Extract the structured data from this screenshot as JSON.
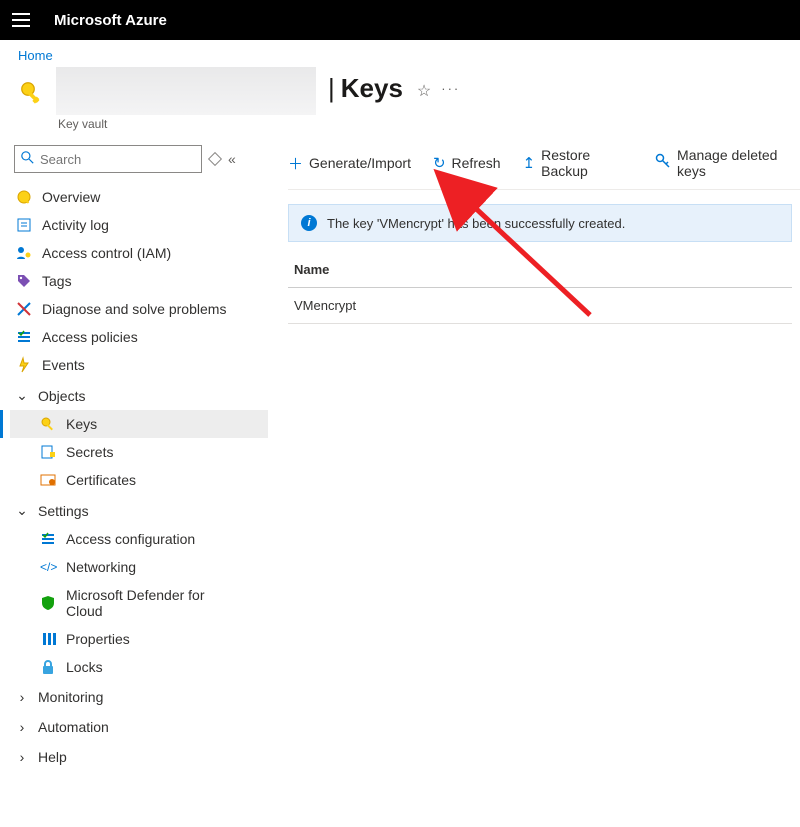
{
  "topbar": {
    "brand": "Microsoft Azure"
  },
  "breadcrumb": {
    "home": "Home"
  },
  "header": {
    "subtitle": "Key vault",
    "separator": "|",
    "title": "Keys",
    "more": "···"
  },
  "sidebar": {
    "search_placeholder": "Search",
    "items": {
      "overview": "Overview",
      "activity": "Activity log",
      "iam": "Access control (IAM)",
      "tags": "Tags",
      "diagnose": "Diagnose and solve problems",
      "accesspolicies": "Access policies",
      "events": "Events"
    },
    "sections": {
      "objects": "Objects",
      "settings": "Settings",
      "monitoring": "Monitoring",
      "automation": "Automation",
      "help": "Help"
    },
    "objects": {
      "keys": "Keys",
      "secrets": "Secrets",
      "certificates": "Certificates"
    },
    "settings": {
      "accessconfig": "Access configuration",
      "networking": "Networking",
      "defender": "Microsoft Defender for Cloud",
      "properties": "Properties",
      "locks": "Locks"
    }
  },
  "toolbar": {
    "generate": "Generate/Import",
    "refresh": "Refresh",
    "restore": "Restore Backup",
    "managedeleted": "Manage deleted keys"
  },
  "notification": {
    "text": "The key 'VMencrypt' has been successfully created."
  },
  "table": {
    "head_name": "Name",
    "row0_name": "VMencrypt"
  }
}
